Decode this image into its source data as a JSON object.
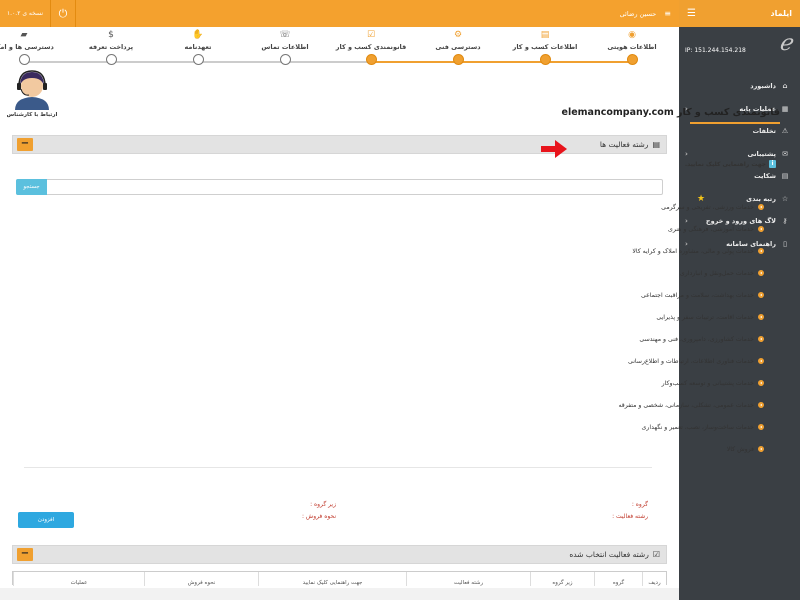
{
  "topbar": {
    "version": "نسخه ی ۱.۰.۲",
    "user_name": "حسین رضائی"
  },
  "sidebar": {
    "app_name": "ایلماد",
    "ip_label": "IP: 151.244.154.218",
    "items": [
      {
        "label": "داشبورد",
        "icon": "home-icon",
        "chevron": false,
        "star": false
      },
      {
        "label": "عملیات پایه",
        "icon": "list-icon",
        "chevron": true,
        "star": false
      },
      {
        "label": "تخلفات",
        "icon": "warning-icon",
        "chevron": false,
        "star": false
      },
      {
        "label": "پشتیبانی",
        "icon": "chat-icon",
        "chevron": true,
        "star": false
      },
      {
        "label": "شکایت",
        "icon": "document-icon",
        "chevron": false,
        "star": false
      },
      {
        "label": "رتبه بندی",
        "icon": "star-icon",
        "chevron": false,
        "star": true
      },
      {
        "label": "لاگ های ورود و خروج",
        "icon": "key-icon",
        "chevron": true,
        "star": false
      },
      {
        "label": "راهنمای سامانه",
        "icon": "file-icon",
        "chevron": true,
        "star": false
      }
    ]
  },
  "steps": [
    {
      "label": "اطلاعات هویتی",
      "icon": "user-icon",
      "active": true
    },
    {
      "label": "اطلاعات کسب و کار",
      "icon": "document-icon",
      "active": true
    },
    {
      "label": "دسترسی فنی",
      "icon": "gears-icon",
      "active": true
    },
    {
      "label": "قانونمندی کسب و کار",
      "icon": "check-square-icon",
      "active": true
    },
    {
      "label": "اطلاعات تماس",
      "icon": "phone-icon",
      "active": false
    },
    {
      "label": "تعهدنامه",
      "icon": "handshake-icon",
      "active": false
    },
    {
      "label": "پرداخت تعرفه",
      "icon": "dollar-icon",
      "active": false
    },
    {
      "label": "دسترسی ها و امکا",
      "icon": "folder-icon",
      "active": false
    }
  ],
  "support": {
    "label": "ارتباط با کارشناس"
  },
  "page": {
    "title": "قانونمندی کسب و کار elemancompany.com"
  },
  "activity_panel": {
    "title": "رشته فعالیت ها",
    "toggle": "−",
    "hint": "جهت راهنمایی کلیک نمایید.",
    "hint_icon": "i",
    "search_button": "جستجو",
    "search_value": "",
    "categories": [
      "خدمات ورزشی، تفریحی و سرگرمی",
      "خدمات آموزشی، فرهنگی و هنری",
      "خدمات پولی و مالی، مشاوره املاک و کرایه کالا",
      "خدمات حمل‌ونقل و انبارداری",
      "خدمات بهداشت، سلامت و مراقبت اجتماعی",
      "خدمات اقامت، ترتیبات سفر و پذیرایی",
      "خدمات کشاورزی، دامپروری، فنی و مهندسی",
      "خدمات فناوری اطلاعات، ارتباطات و اطلاع‌رسانی",
      "خدمات پشتیبانی و توسعه کسب‌وکار",
      "خدمات عمومی، تشکلی، سازمانی، شخصی و متفرقه",
      "خدمات ساخت‌وساز، نصب، تعمیر و نگهداری",
      "فروش کالا"
    ],
    "group_label": "گروه :",
    "subgroup_label": "زیر گروه :",
    "activity_label": "رشته فعالیت :",
    "sale_method_label": "نحوه فروش :",
    "submit_button": "افزودن"
  },
  "selected_panel": {
    "title": "رشته فعالیت انتخاب شده",
    "toggle": "−",
    "columns": [
      "ردیف",
      "گروه",
      "زیر گروه",
      "رشته فعالیت",
      "جهت راهنمایی کلیک نمایید",
      "نحوه فروش",
      "عملیات"
    ]
  },
  "colors": {
    "accent": "#f0a030",
    "sidebar_bg": "#3a3f44",
    "info": "#5bc0de",
    "primary_button": "#2ea8e0",
    "arrow": "#e8141c"
  }
}
